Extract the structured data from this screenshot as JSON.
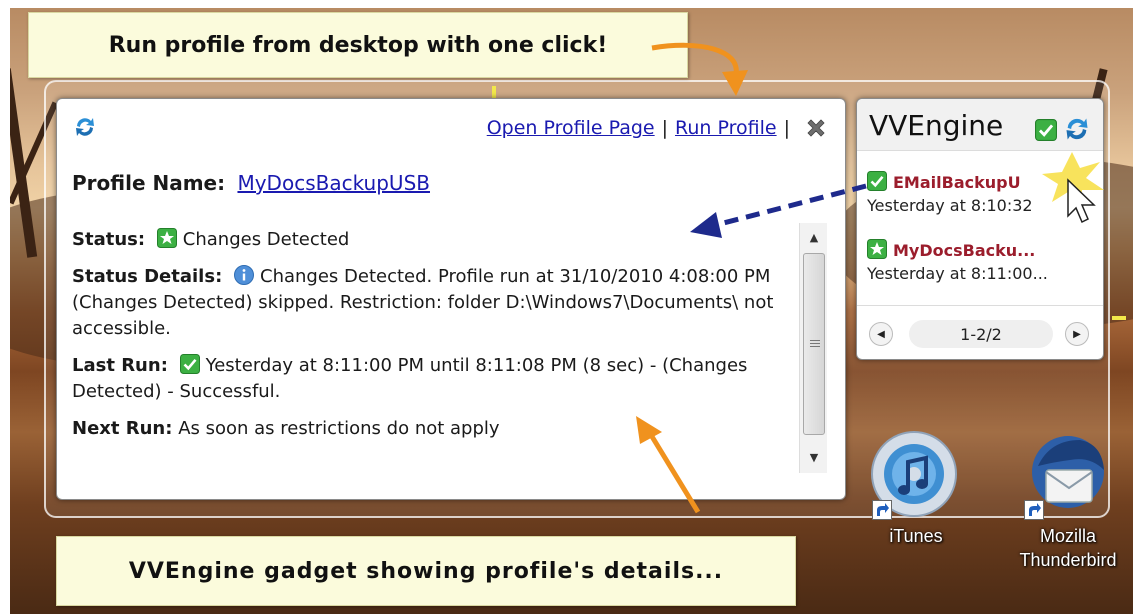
{
  "callouts": {
    "top": "Run profile from desktop with one click!",
    "bottom": "VVEngine gadget showing profile's details..."
  },
  "details_gadget": {
    "links": {
      "open_profile_page": "Open Profile Page",
      "separator": "|",
      "run_profile": "Run Profile"
    },
    "profile_label": "Profile Name:",
    "profile_name": "MyDocsBackupUSB",
    "status": {
      "label": "Status:",
      "value": "Changes Detected",
      "icon": "green-star-icon"
    },
    "status_details": {
      "label": "Status Details:",
      "value": "Changes Detected. Profile run at 31/10/2010 4:08:00 PM (Changes Detected) skipped. Restriction: folder D:\\Windows7\\Documents\\ not accessible.",
      "icon": "info-icon"
    },
    "last_run": {
      "label": "Last Run:",
      "value": "Yesterday at 8:11:00 PM until 8:11:08 PM (8 sec) - (Changes Detected) - Successful.",
      "icon": "green-check-icon"
    },
    "next_run": {
      "label": "Next Run:",
      "value": "As soon as restrictions do not apply"
    }
  },
  "small_gadget": {
    "title": "VVEngine",
    "profiles": [
      {
        "name": "EMailBackupU",
        "time": "Yesterday at 8:10:32",
        "icon": "green-check-icon"
      },
      {
        "name": "MyDocsBacku...",
        "time": "Yesterday at 8:11:00...",
        "icon": "green-star-icon"
      }
    ],
    "pager": "1-2/2"
  },
  "desktop_icons": [
    {
      "label": "iTunes",
      "icon": "itunes-icon"
    },
    {
      "label": "Mozilla Thunderbird",
      "icon": "thunderbird-icon"
    }
  ],
  "colors": {
    "link": "#1a1ab0",
    "profile_red": "#9b1d2c",
    "callout_bg": "#fbfbdc",
    "arrow_orange": "#f0921e",
    "arrow_navy": "#1e2a8c",
    "status_green": "#3cb043"
  }
}
